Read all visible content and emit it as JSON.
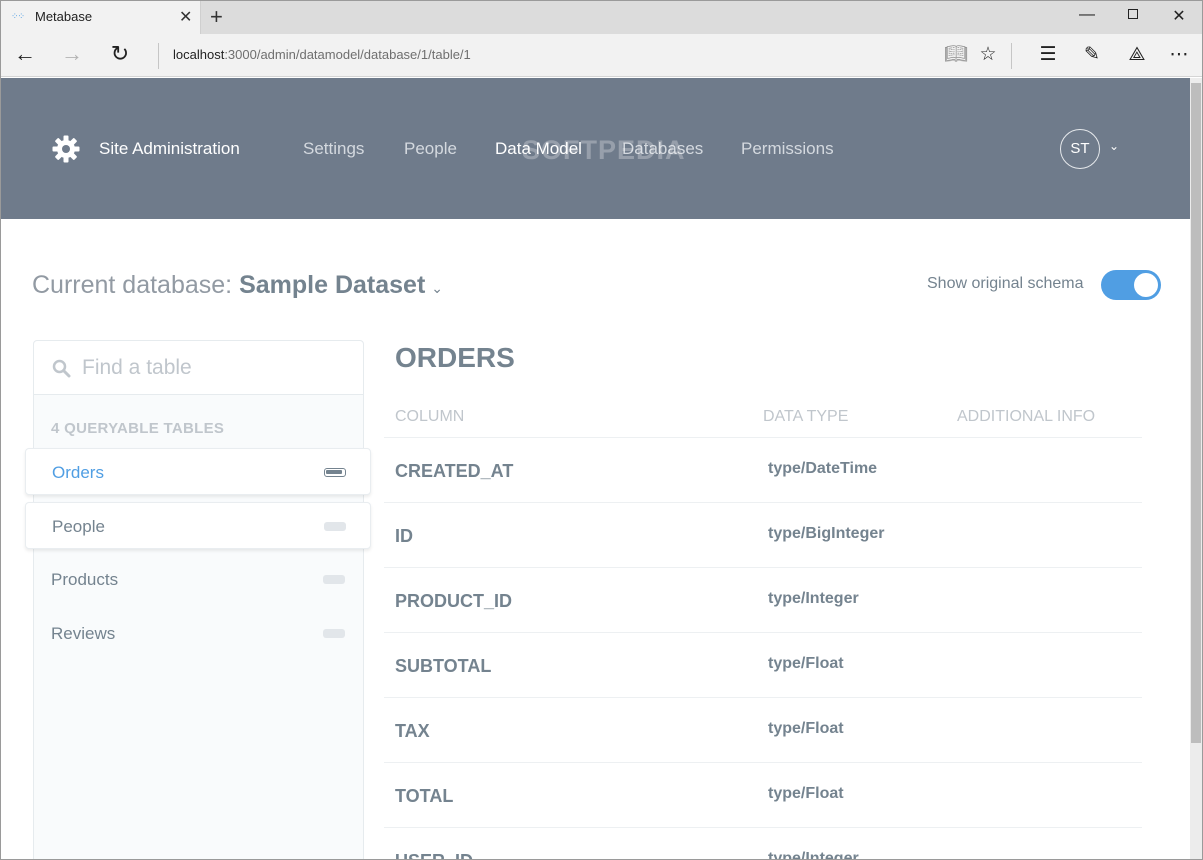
{
  "browser": {
    "tab_title": "Metabase",
    "tab_close": "✕",
    "new_tab": "+",
    "address_host": "localhost",
    "address_path": ":3000/admin/datamodel/database/1/table/1"
  },
  "header": {
    "site_admin": "Site Administration",
    "nav": [
      {
        "label": "Settings",
        "active": false
      },
      {
        "label": "People",
        "active": false
      },
      {
        "label": "Data Model",
        "active": true
      },
      {
        "label": "Databases",
        "active": false
      },
      {
        "label": "Permissions",
        "active": false
      }
    ],
    "watermark": "SOFTPEDIA",
    "avatar_initials": "ST"
  },
  "database": {
    "prefix": "Current database:",
    "name": "Sample Dataset",
    "show_original_schema": "Show original schema",
    "toggle_on": true
  },
  "sidebar": {
    "search_placeholder": "Find a table",
    "count_label": "4 QUERYABLE TABLES",
    "tables": [
      "Orders",
      "People",
      "Products",
      "Reviews"
    ],
    "selected": "Orders"
  },
  "main": {
    "table_title": "ORDERS",
    "headers": {
      "column": "COLUMN",
      "type": "DATA TYPE",
      "info": "ADDITIONAL INFO"
    },
    "rows": [
      {
        "name": "CREATED_AT",
        "type": "type/DateTime"
      },
      {
        "name": "ID",
        "type": "type/BigInteger"
      },
      {
        "name": "PRODUCT_ID",
        "type": "type/Integer"
      },
      {
        "name": "SUBTOTAL",
        "type": "type/Float"
      },
      {
        "name": "TAX",
        "type": "type/Float"
      },
      {
        "name": "TOTAL",
        "type": "type/Float"
      },
      {
        "name": "USER_ID",
        "type": "type/Integer"
      }
    ]
  },
  "colors": {
    "brand": "#509EE3",
    "header_bg": "#6F7B8B",
    "text": "#74838F"
  }
}
